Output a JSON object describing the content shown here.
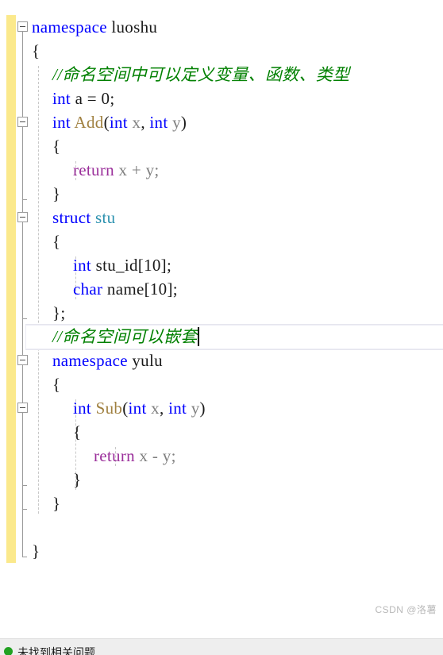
{
  "editor": {
    "language": "cpp",
    "colors": {
      "background": "#ffffff",
      "keyword": "#0000ff",
      "user_type": "#2b91af",
      "function": "#a08040",
      "control_keyword": "#9b309b",
      "comment": "#008000",
      "identifier": "#1a1a1a",
      "parameter": "#808080",
      "change_bar_unsaved": "#fbe98c",
      "indent_guide": "#c8c8c8",
      "outline_glyph": "#9a9a9a",
      "current_line_border": "#e6e6ee"
    },
    "current_line_number": 13,
    "caret_visible": true,
    "lines": [
      {
        "n": 1,
        "indent": 0,
        "fold": "open",
        "tokens": [
          {
            "t": "namespace",
            "c": "kw"
          },
          {
            "t": " ",
            "c": "pln"
          },
          {
            "t": "luoshu",
            "c": "pln"
          }
        ]
      },
      {
        "n": 2,
        "indent": 0,
        "fold": null,
        "tokens": [
          {
            "t": "{",
            "c": "brc"
          }
        ]
      },
      {
        "n": 3,
        "indent": 1,
        "fold": null,
        "tokens": [
          {
            "t": "//命名空间中可以定义变量、函数、类型",
            "c": "cmt"
          }
        ]
      },
      {
        "n": 4,
        "indent": 1,
        "fold": null,
        "tokens": [
          {
            "t": "int",
            "c": "kw"
          },
          {
            "t": " a = ",
            "c": "pln"
          },
          {
            "t": "0",
            "c": "num"
          },
          {
            "t": ";",
            "c": "pln"
          }
        ]
      },
      {
        "n": 5,
        "indent": 1,
        "fold": "open",
        "tokens": [
          {
            "t": "int",
            "c": "kw"
          },
          {
            "t": " ",
            "c": "pln"
          },
          {
            "t": "Add",
            "c": "fn"
          },
          {
            "t": "(",
            "c": "pln"
          },
          {
            "t": "int",
            "c": "kw"
          },
          {
            "t": " ",
            "c": "pln"
          },
          {
            "t": "x",
            "c": "var"
          },
          {
            "t": ", ",
            "c": "pln"
          },
          {
            "t": "int",
            "c": "kw"
          },
          {
            "t": " ",
            "c": "pln"
          },
          {
            "t": "y",
            "c": "var"
          },
          {
            "t": ")",
            "c": "pln"
          }
        ]
      },
      {
        "n": 6,
        "indent": 1,
        "fold": null,
        "tokens": [
          {
            "t": "{",
            "c": "brc"
          }
        ]
      },
      {
        "n": 7,
        "indent": 2,
        "fold": null,
        "tokens": [
          {
            "t": "return",
            "c": "ctl"
          },
          {
            "t": " ",
            "c": "pln"
          },
          {
            "t": "x",
            "c": "var"
          },
          {
            "t": " ",
            "c": "pln"
          },
          {
            "t": "+",
            "c": "var"
          },
          {
            "t": " ",
            "c": "pln"
          },
          {
            "t": "y",
            "c": "var"
          },
          {
            "t": ";",
            "c": "var"
          }
        ]
      },
      {
        "n": 8,
        "indent": 1,
        "fold": null,
        "tokens": [
          {
            "t": "}",
            "c": "brc"
          }
        ]
      },
      {
        "n": 9,
        "indent": 1,
        "fold": "open",
        "tokens": [
          {
            "t": "struct",
            "c": "kw"
          },
          {
            "t": " ",
            "c": "pln"
          },
          {
            "t": "stu",
            "c": "typ"
          }
        ]
      },
      {
        "n": 10,
        "indent": 1,
        "fold": null,
        "tokens": [
          {
            "t": "{",
            "c": "brc"
          }
        ]
      },
      {
        "n": 11,
        "indent": 2,
        "fold": null,
        "tokens": [
          {
            "t": "int",
            "c": "kw"
          },
          {
            "t": " stu_id[",
            "c": "pln"
          },
          {
            "t": "10",
            "c": "num"
          },
          {
            "t": "];",
            "c": "pln"
          }
        ]
      },
      {
        "n": 12,
        "indent": 2,
        "fold": null,
        "tokens": [
          {
            "t": "char",
            "c": "kw"
          },
          {
            "t": " name[",
            "c": "pln"
          },
          {
            "t": "10",
            "c": "num"
          },
          {
            "t": "];",
            "c": "pln"
          }
        ]
      },
      {
        "n": 13,
        "indent": 1,
        "fold": null,
        "tokens": [
          {
            "t": "};",
            "c": "brc"
          }
        ]
      },
      {
        "n": 14,
        "indent": 1,
        "fold": null,
        "current": true,
        "tokens": [
          {
            "t": "//命名空间可以嵌套",
            "c": "cmt"
          }
        ]
      },
      {
        "n": 15,
        "indent": 1,
        "fold": "open",
        "tokens": [
          {
            "t": "namespace",
            "c": "kw"
          },
          {
            "t": " ",
            "c": "pln"
          },
          {
            "t": "yulu",
            "c": "pln"
          }
        ]
      },
      {
        "n": 16,
        "indent": 1,
        "fold": null,
        "tokens": [
          {
            "t": "{",
            "c": "brc"
          }
        ]
      },
      {
        "n": 17,
        "indent": 2,
        "fold": "open",
        "tokens": [
          {
            "t": "int",
            "c": "kw"
          },
          {
            "t": " ",
            "c": "pln"
          },
          {
            "t": "Sub",
            "c": "fn"
          },
          {
            "t": "(",
            "c": "pln"
          },
          {
            "t": "int",
            "c": "kw"
          },
          {
            "t": " ",
            "c": "pln"
          },
          {
            "t": "x",
            "c": "var"
          },
          {
            "t": ", ",
            "c": "pln"
          },
          {
            "t": "int",
            "c": "kw"
          },
          {
            "t": " ",
            "c": "pln"
          },
          {
            "t": "y",
            "c": "var"
          },
          {
            "t": ")",
            "c": "pln"
          }
        ]
      },
      {
        "n": 18,
        "indent": 2,
        "fold": null,
        "tokens": [
          {
            "t": "{",
            "c": "brc"
          }
        ]
      },
      {
        "n": 19,
        "indent": 3,
        "fold": null,
        "tokens": [
          {
            "t": "return",
            "c": "ctl"
          },
          {
            "t": " ",
            "c": "pln"
          },
          {
            "t": "x",
            "c": "var"
          },
          {
            "t": " ",
            "c": "pln"
          },
          {
            "t": "-",
            "c": "var"
          },
          {
            "t": " ",
            "c": "pln"
          },
          {
            "t": "y",
            "c": "var"
          },
          {
            "t": ";",
            "c": "var"
          }
        ]
      },
      {
        "n": 20,
        "indent": 2,
        "fold": null,
        "tokens": [
          {
            "t": "}",
            "c": "brc"
          }
        ]
      },
      {
        "n": 21,
        "indent": 1,
        "fold": null,
        "tokens": [
          {
            "t": "}",
            "c": "brc"
          }
        ]
      },
      {
        "n": 22,
        "indent": 0,
        "fold": null,
        "tokens": []
      },
      {
        "n": 23,
        "indent": 0,
        "fold": null,
        "tokens": [
          {
            "t": "}",
            "c": "brc"
          }
        ]
      }
    ]
  },
  "watermark": {
    "text": "CSDN @洛薯"
  },
  "status_bar": {
    "icon": "green-circle-icon",
    "text": "未找到相关问题"
  }
}
